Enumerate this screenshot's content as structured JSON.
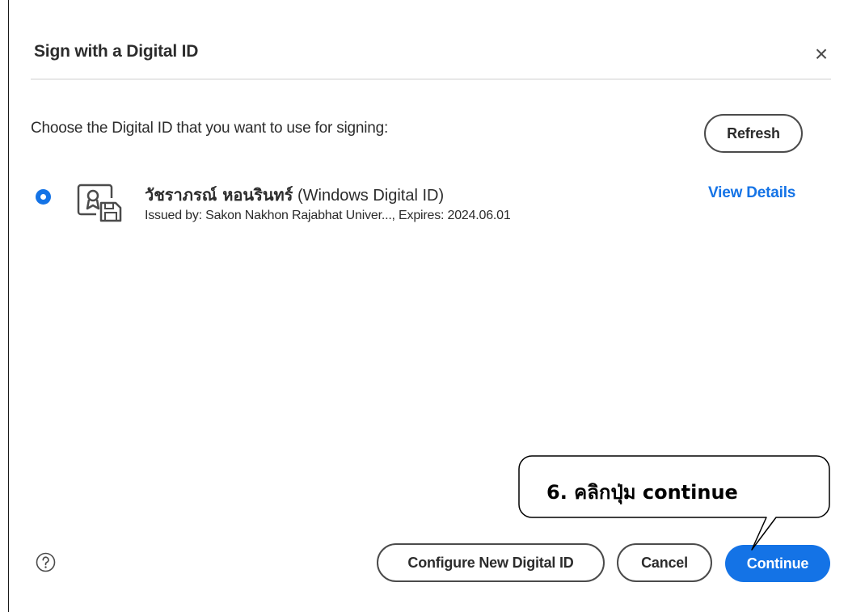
{
  "dialog": {
    "title": "Sign with a Digital ID",
    "close_glyph": "×"
  },
  "prompt": "Choose the Digital ID that you want to use for signing:",
  "refresh_label": "Refresh",
  "digital_id": {
    "name": "วัชราภรณ์ หอนรินทร์",
    "type": " (Windows Digital ID)",
    "issuer_line": "Issued by: Sakon Nakhon Rajabhat Univer..., Expires: 2024.06.01",
    "view_details_label": "View Details",
    "selected": true,
    "icon": "certificate-icon"
  },
  "footer": {
    "help_icon": "help-icon",
    "configure_label": "Configure New Digital ID",
    "cancel_label": "Cancel",
    "continue_label": "Continue"
  },
  "callout": {
    "text": "6. คลิกปุ่ม continue"
  },
  "colors": {
    "accent": "#1473e6",
    "text": "#2c2c2c",
    "border": "#4b4b4b",
    "divider": "#e8e8e8"
  }
}
